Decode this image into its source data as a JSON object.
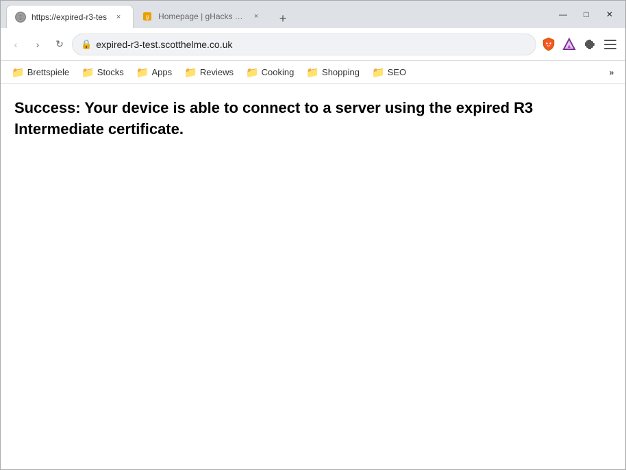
{
  "window": {
    "title": "Brave Browser"
  },
  "titlebar": {
    "active_tab": {
      "favicon": "🌐",
      "title": "https://expired-r3-tes",
      "close": "×"
    },
    "inactive_tab": {
      "favicon": "📄",
      "title": "Homepage | gHacks Tech",
      "close": "×"
    },
    "new_tab_btn": "+",
    "window_controls": {
      "minimize": "—",
      "maximize": "□",
      "close": "✕"
    }
  },
  "navbar": {
    "back": "‹",
    "forward": "›",
    "reload": "↻",
    "home": "⌂",
    "address": "expired-r3-test.scotthelme.co.uk",
    "lock": "🔒"
  },
  "bookmarks": [
    {
      "label": "Brettspiele"
    },
    {
      "label": "Stocks"
    },
    {
      "label": "Apps"
    },
    {
      "label": "Reviews"
    },
    {
      "label": "Cooking"
    },
    {
      "label": "Shopping"
    },
    {
      "label": "SEO"
    }
  ],
  "more_bookmarks": "»",
  "page": {
    "success_text": "Success: Your device is able to connect to a server using the expired R3 Intermediate certificate."
  }
}
